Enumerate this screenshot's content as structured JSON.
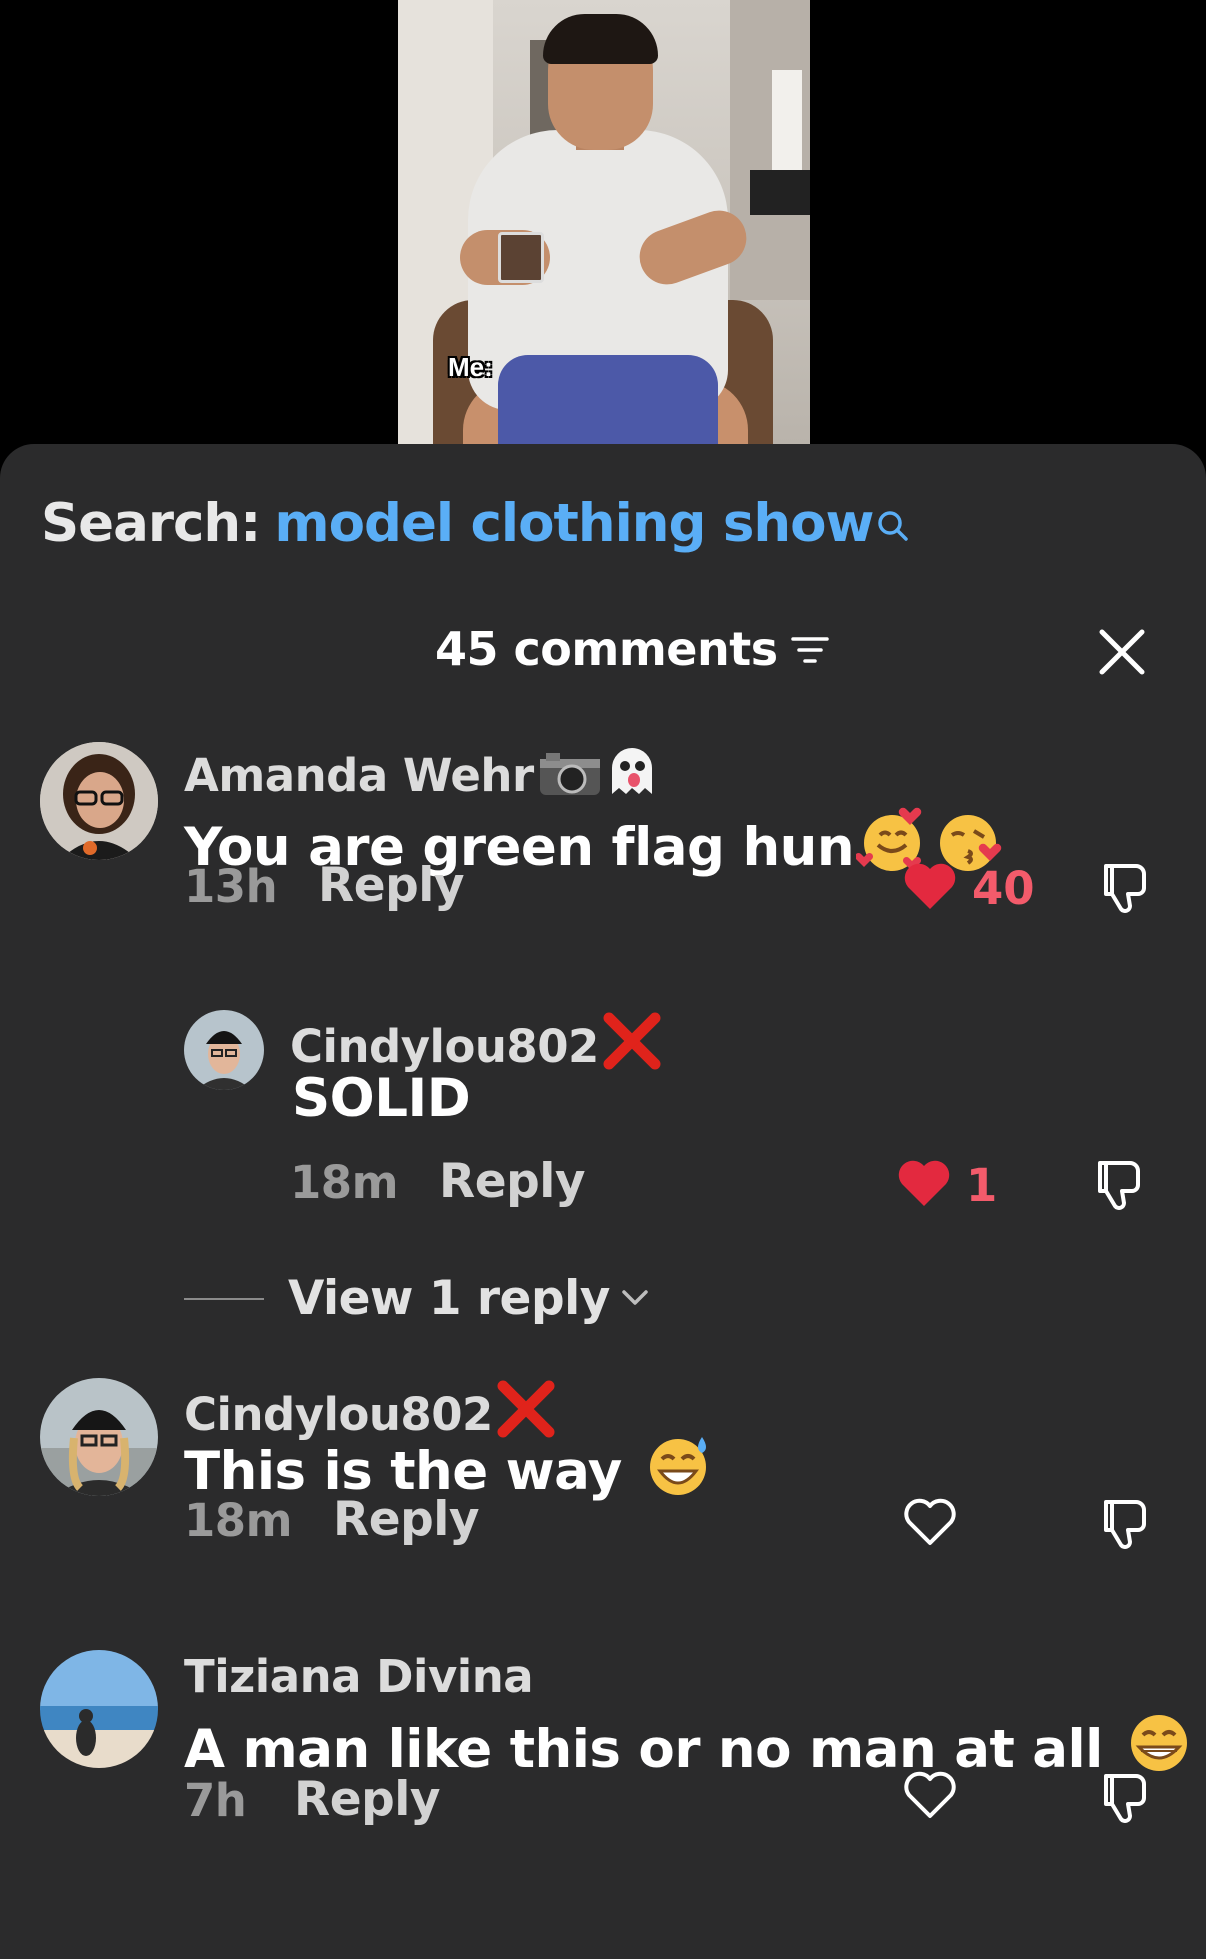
{
  "video": {
    "caption": "Me:"
  },
  "search": {
    "label": "Search:",
    "term": "model clothing show"
  },
  "header": {
    "count_label": "45 comments"
  },
  "comments": [
    {
      "user": "Amanda Wehr",
      "text": "You are green flag hun",
      "time": "13h",
      "reply_label": "Reply",
      "likes": "40",
      "liked": true
    },
    {
      "user": "Cindylou802",
      "text": "SOLID",
      "time": "18m",
      "reply_label": "Reply",
      "likes": "1",
      "liked": true
    },
    {
      "user": "Cindylou802",
      "text": "This is the way",
      "time": "18m",
      "reply_label": "Reply",
      "likes": "",
      "liked": false
    },
    {
      "user": "Tiziana Divina",
      "text": "A man like this or no man at all",
      "time": "7h",
      "reply_label": "Reply",
      "likes": "",
      "liked": false
    }
  ],
  "view_replies": {
    "label": "View 1 reply"
  },
  "colors": {
    "accent_link": "#5aaef6",
    "like_red": "#e3293f",
    "sheet_bg": "#2b2b2c"
  },
  "icons": [
    "search-icon",
    "filter-icon",
    "close-icon",
    "camera-icon",
    "ghost-icon",
    "smiling-hearts-emoji",
    "kiss-emoji",
    "red-x-icon",
    "sweat-smile-emoji",
    "grin-emoji",
    "heart-icon",
    "thumbs-down-icon",
    "chevron-down-icon"
  ]
}
